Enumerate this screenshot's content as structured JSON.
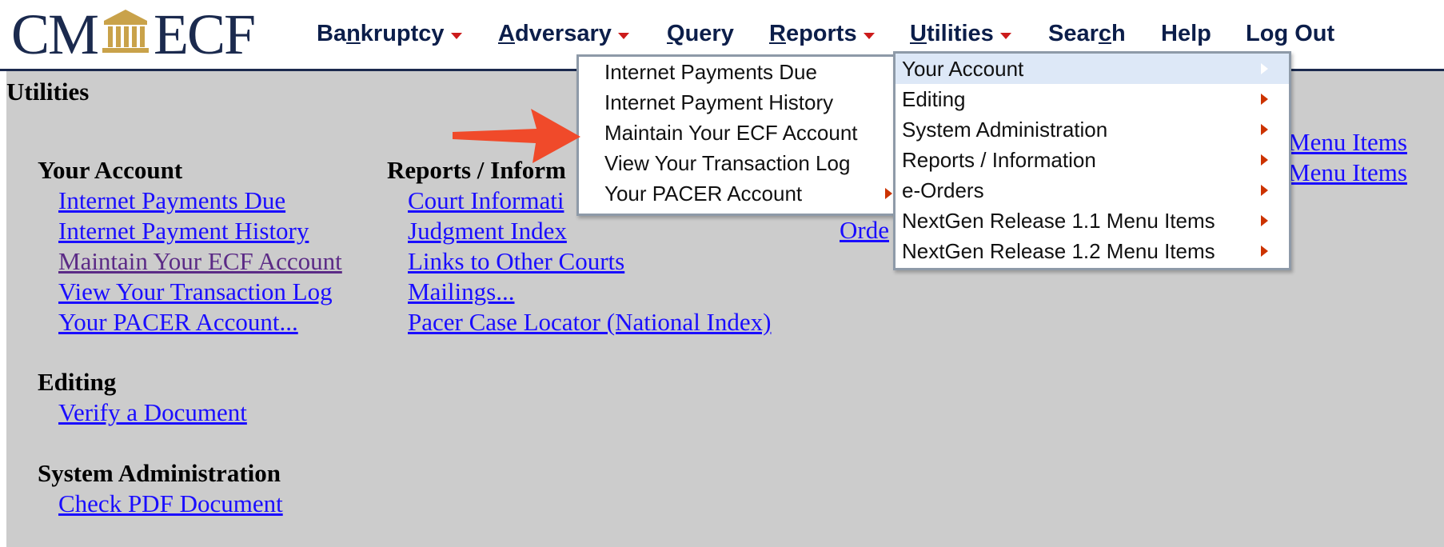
{
  "logo": {
    "left": "CM",
    "right": "ECF",
    "icon": "courthouse-icon"
  },
  "nav": {
    "bankruptcy": {
      "pre": "Ba",
      "ul": "n",
      "post": "kruptcy"
    },
    "adversary": {
      "pre": "",
      "ul": "A",
      "post": "dversary"
    },
    "query": {
      "pre": "",
      "ul": "Q",
      "post": "uery"
    },
    "reports": {
      "pre": "",
      "ul": "R",
      "post": "eports"
    },
    "utilities": {
      "pre": "",
      "ul": "U",
      "post": "tilities"
    },
    "search": {
      "pre": "Sear",
      "ul": "c",
      "post": "h"
    },
    "help": "Help",
    "logout": {
      "pre": "Lo",
      "ul": "g",
      "post": " Out"
    }
  },
  "page_title": "Utilities",
  "sections": {
    "your_account": {
      "heading": "Your Account",
      "links": [
        "Internet Payments Due",
        "Internet Payment History",
        "Maintain Your ECF Account",
        "View Your Transaction Log",
        "Your PACER Account..."
      ]
    },
    "reports": {
      "heading": "Reports / Inform",
      "links": [
        "Court Informati",
        "Judgment Index",
        "Links to Other Courts",
        "Mailings...",
        "Pacer Case Locator (National Index)"
      ]
    },
    "editing": {
      "heading": "Editing",
      "links": [
        "Verify a Document"
      ]
    },
    "system_admin": {
      "heading": "System Administration",
      "links": [
        "Check PDF Document"
      ]
    },
    "eorders_fragments": [
      "Orde"
    ],
    "right_fragments": [
      "Menu Items",
      "Menu Items"
    ]
  },
  "utilities_menu": {
    "items": [
      "Your Account",
      "Editing",
      "System Administration",
      "Reports / Information",
      "e-Orders",
      "NextGen Release 1.1 Menu Items",
      "NextGen Release 1.2 Menu Items"
    ],
    "highlighted": "Your Account"
  },
  "your_account_menu": {
    "items": [
      "Internet Payments Due",
      "Internet Payment History",
      "Maintain Your ECF Account",
      "View Your Transaction Log",
      "Your PACER Account"
    ]
  },
  "colors": {
    "navy": "#1b2a4e",
    "link": "#1a0dff",
    "visited": "#5b2a86",
    "caret": "#cc1b1b",
    "arrow": "#f04a2a",
    "background": "#cccccc",
    "highlight": "#dde8f7"
  }
}
